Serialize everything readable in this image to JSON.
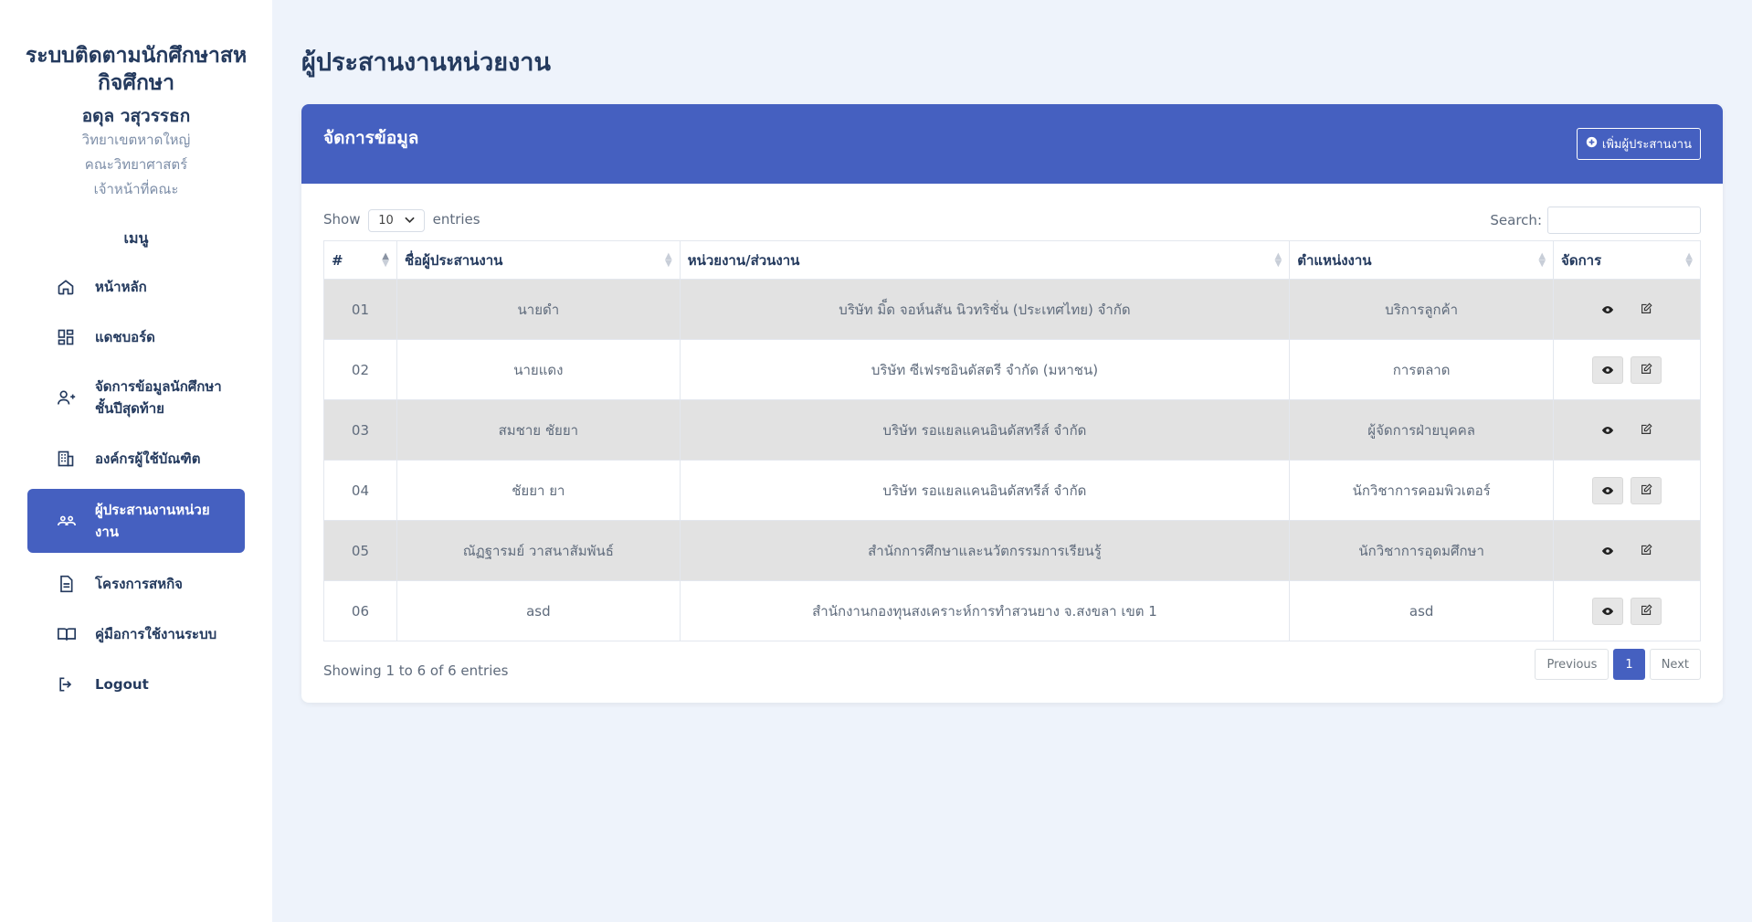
{
  "brand": {
    "title": "ระบบติดตามนักศึกษาสหกิจศึกษา"
  },
  "user": {
    "name": "อดุล วสุวรรธก",
    "campus": "วิทยาเขตหาดใหญ่",
    "faculty": "คณะวิทยาศาสตร์",
    "role": "เจ้าหน้าที่คณะ"
  },
  "menu": {
    "heading": "เมนู",
    "items": [
      {
        "label": "หน้าหลัก",
        "icon": "home-icon"
      },
      {
        "label": "แดชบอร์ด",
        "icon": "dashboard-icon"
      },
      {
        "label": "จัดการข้อมูลนักศึกษาชั้นปีสุดท้าย",
        "icon": "user-plus-icon"
      },
      {
        "label": "องค์กรผู้ใช้บัณฑิต",
        "icon": "building-icon"
      },
      {
        "label": "ผู้ประสานงานหน่วยงาน",
        "icon": "users-icon",
        "active": true
      },
      {
        "label": "โครงการสหกิจ",
        "icon": "document-icon"
      },
      {
        "label": "คู่มือการใช้งานระบบ",
        "icon": "book-icon"
      },
      {
        "label": "Logout",
        "icon": "logout-icon"
      }
    ]
  },
  "page": {
    "title": "ผู้ประสานงานหน่วยงาน"
  },
  "card": {
    "title": "จัดการข้อมูล",
    "add_label": "เพิ่มผู้ประสานงาน"
  },
  "controls": {
    "show_label": "Show",
    "length_value": "10",
    "entries_label": "entries",
    "search_label": "Search:",
    "search_value": ""
  },
  "table": {
    "headers": [
      "#",
      "ชื่อผู้ประสานงาน",
      "หน่วยงาน/ส่วนงาน",
      "ตำแหน่งงาน",
      "จัดการ"
    ],
    "rows": [
      [
        "01",
        "นายดำ",
        "บริษัท มิ็ด จอห์นสัน นิวทริชั่น (ประเทศไทย) จำกัด",
        "บริการลูกค้า"
      ],
      [
        "02",
        "นายแดง",
        "บริษัท ซีเฟรซอินดัสตรี จำกัด (มหาชน)",
        "การตลาด"
      ],
      [
        "03",
        "สมชาย ชัยยา",
        "บริษัท รอแยลแคนอินดัสทรีส์ จำกัด",
        "ผู้จัดการฝ่ายบุคคล"
      ],
      [
        "04",
        "ชัยยา ยา",
        "บริษัท รอแยลแคนอินดัสทรีส์ จำกัด",
        "นักวิชาการคอมพิวเตอร์"
      ],
      [
        "05",
        "ณัฏฐารมย์ วาสนาสัมพันธ์",
        "สำนักการศึกษาและนวัตกรรมการเรียนรู้",
        "นักวิชาการอุดมศึกษา"
      ],
      [
        "06",
        "asd",
        "สำนักงานกองทุนสงเคราะห์การทำสวนยาง จ.สงขลา เขต 1",
        "asd"
      ]
    ]
  },
  "footer": {
    "info": "Showing 1 to 6 of 6 entries",
    "prev": "Previous",
    "page": "1",
    "next": "Next"
  },
  "colors": {
    "accent": "#4560c0",
    "background": "#eef3fb",
    "text": "#243a5e"
  }
}
